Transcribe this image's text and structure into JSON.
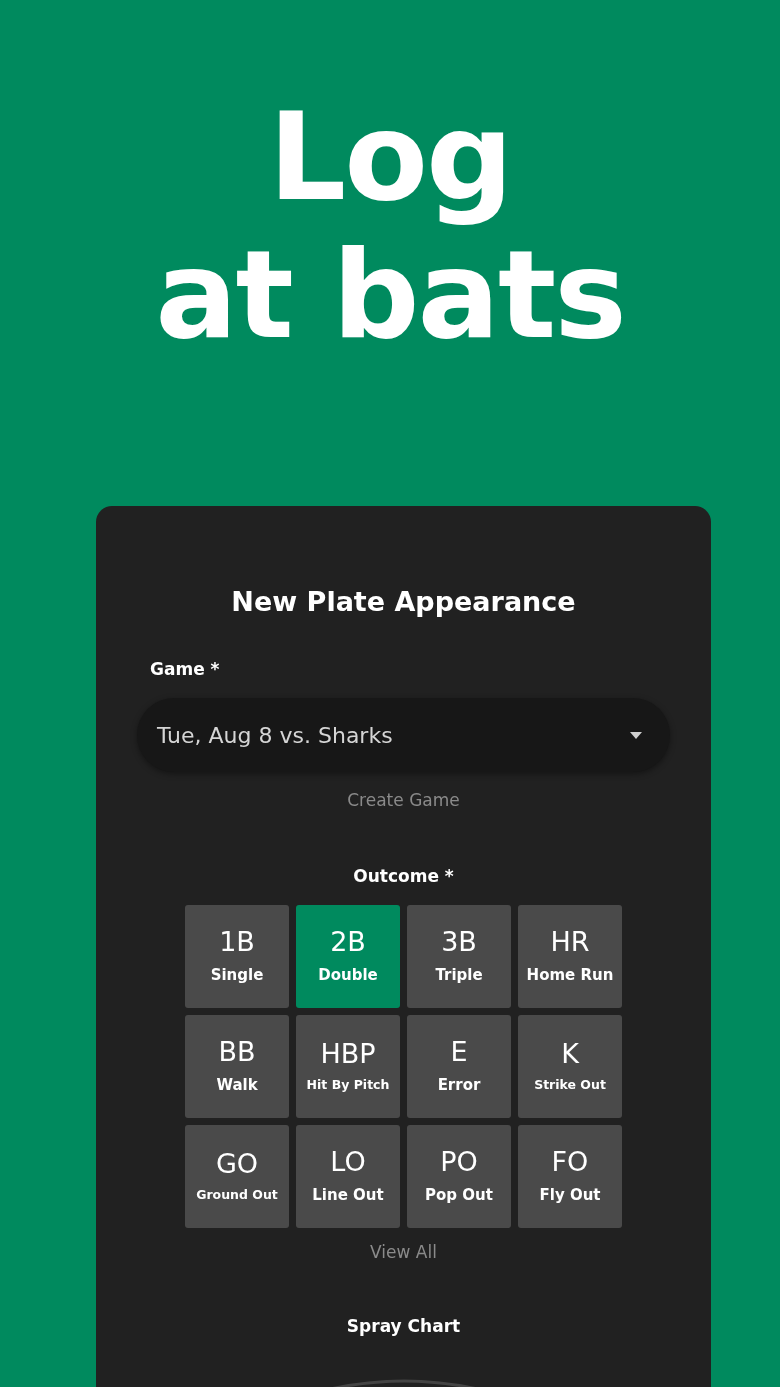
{
  "headline": [
    "Log",
    "at bats"
  ],
  "card": {
    "title": "New Plate Appearance",
    "game_field": {
      "label": "Game *",
      "value": "Tue, Aug 8 vs. Sharks"
    },
    "create_link": "Create Game",
    "outcome": {
      "label": "Outcome *",
      "options": [
        {
          "code": "1B",
          "name": "Single",
          "selected": false
        },
        {
          "code": "2B",
          "name": "Double",
          "selected": true
        },
        {
          "code": "3B",
          "name": "Triple",
          "selected": false
        },
        {
          "code": "HR",
          "name": "Home Run",
          "selected": false
        },
        {
          "code": "BB",
          "name": "Walk",
          "selected": false
        },
        {
          "code": "HBP",
          "name": "Hit By Pitch",
          "selected": false
        },
        {
          "code": "E",
          "name": "Error",
          "selected": false
        },
        {
          "code": "K",
          "name": "Strike Out",
          "selected": false
        },
        {
          "code": "GO",
          "name": "Ground Out",
          "selected": false
        },
        {
          "code": "LO",
          "name": "Line Out",
          "selected": false
        },
        {
          "code": "PO",
          "name": "Pop Out",
          "selected": false
        },
        {
          "code": "FO",
          "name": "Fly Out",
          "selected": false
        }
      ]
    },
    "view_all_link": "View All",
    "spray_chart": {
      "label": "Spray Chart"
    }
  }
}
